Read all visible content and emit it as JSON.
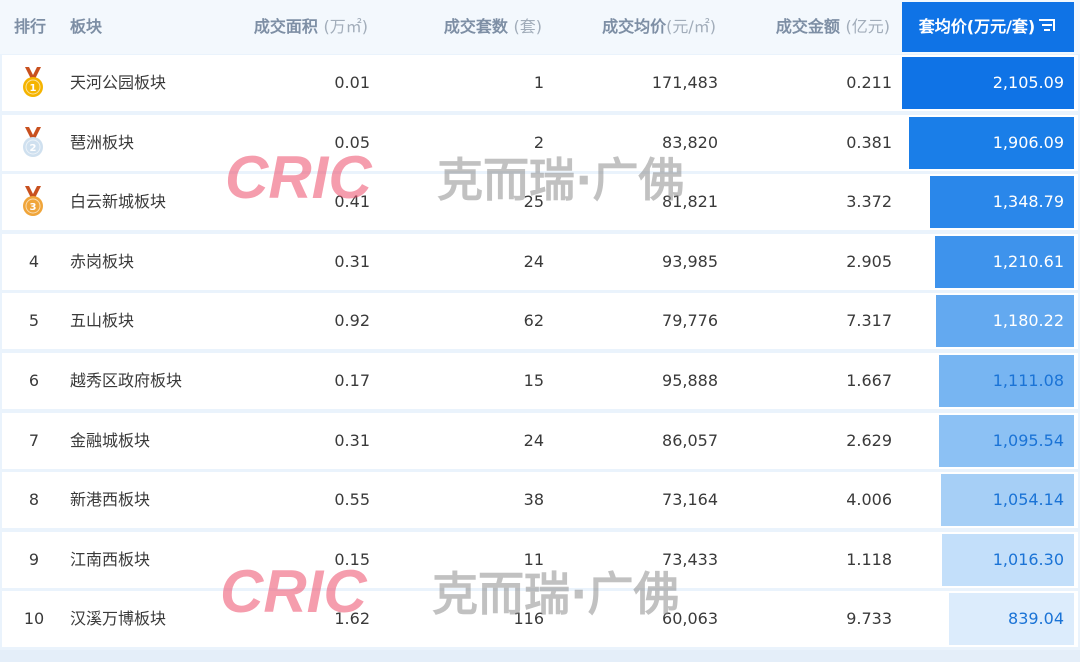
{
  "columns": {
    "rank": "排行",
    "block": "板块",
    "area": "成交面积",
    "area_unit": "(万㎡)",
    "units": "成交套数",
    "units_unit": "(套)",
    "avg_price": "成交均价",
    "avg_price_unit": "(元/㎡)",
    "amount": "成交金额",
    "amount_unit": "(亿元)",
    "unit_price": "套均价",
    "unit_price_unit": "(万元/套)"
  },
  "rows": [
    {
      "rank": "1",
      "name": "天河公园板块",
      "area": "0.01",
      "units": "1",
      "avg_price": "171,483",
      "amount": "0.211",
      "unit_price": "2,105.09",
      "medal": "gold"
    },
    {
      "rank": "2",
      "name": "琶洲板块",
      "area": "0.05",
      "units": "2",
      "avg_price": "83,820",
      "amount": "0.381",
      "unit_price": "1,906.09",
      "medal": "silver"
    },
    {
      "rank": "3",
      "name": "白云新城板块",
      "area": "0.41",
      "units": "25",
      "avg_price": "81,821",
      "amount": "3.372",
      "unit_price": "1,348.79",
      "medal": "bronze"
    },
    {
      "rank": "4",
      "name": "赤岗板块",
      "area": "0.31",
      "units": "24",
      "avg_price": "93,985",
      "amount": "2.905",
      "unit_price": "1,210.61"
    },
    {
      "rank": "5",
      "name": "五山板块",
      "area": "0.92",
      "units": "62",
      "avg_price": "79,776",
      "amount": "7.317",
      "unit_price": "1,180.22"
    },
    {
      "rank": "6",
      "name": "越秀区政府板块",
      "area": "0.17",
      "units": "15",
      "avg_price": "95,888",
      "amount": "1.667",
      "unit_price": "1,111.08"
    },
    {
      "rank": "7",
      "name": "金融城板块",
      "area": "0.31",
      "units": "24",
      "avg_price": "86,057",
      "amount": "2.629",
      "unit_price": "1,095.54"
    },
    {
      "rank": "8",
      "name": "新港西板块",
      "area": "0.55",
      "units": "38",
      "avg_price": "73,164",
      "amount": "4.006",
      "unit_price": "1,054.14"
    },
    {
      "rank": "9",
      "name": "江南西板块",
      "area": "0.15",
      "units": "11",
      "avg_price": "73,433",
      "amount": "1.118",
      "unit_price": "1,016.30"
    },
    {
      "rank": "10",
      "name": "汉溪万博板块",
      "area": "1.62",
      "units": "116",
      "avg_price": "60,063",
      "amount": "9.733",
      "unit_price": "839.04"
    }
  ],
  "bar_colors": [
    "#0f73e6",
    "#1a7ee8",
    "#2a87ea",
    "#3e93ec",
    "#63a9f0",
    "#77b5f2",
    "#8cc1f4",
    "#a6cff6",
    "#c3dffa",
    "#dcecfc"
  ],
  "bar_text_colors": [
    "#ffffff",
    "#ffffff",
    "#ffffff",
    "#ffffff",
    "#ffffff",
    "#1a73d6",
    "#1a73d6",
    "#1a73d6",
    "#1a73d6",
    "#1a73d6"
  ],
  "watermark": {
    "logo": "CRIC",
    "text": "克而瑞·广佛"
  }
}
